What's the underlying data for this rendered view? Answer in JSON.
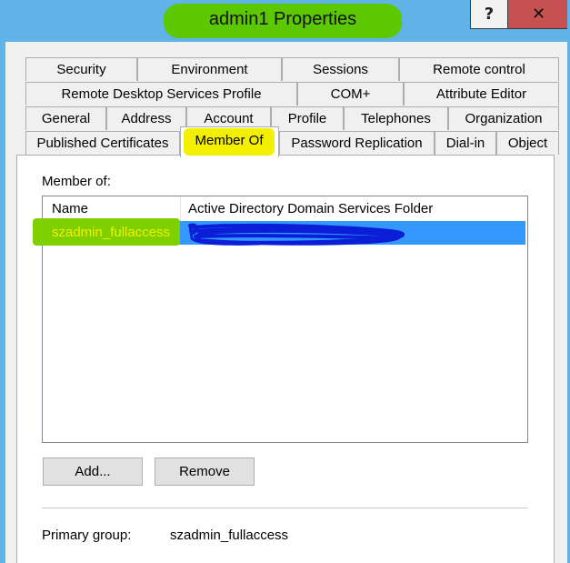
{
  "window": {
    "title": "admin1 Properties",
    "help_label": "?",
    "close_label": "✕"
  },
  "tabs": {
    "row1": [
      "Security",
      "Environment",
      "Sessions",
      "Remote control"
    ],
    "row2": [
      "Remote Desktop Services Profile",
      "COM+",
      "Attribute Editor"
    ],
    "row3": [
      "General",
      "Address",
      "Account",
      "Profile",
      "Telephones",
      "Organization"
    ],
    "row4": [
      "Published Certificates",
      "Member Of",
      "Password Replication",
      "Dial-in",
      "Object"
    ],
    "active": "Member Of"
  },
  "member_of": {
    "label": "Member of:",
    "columns": [
      "Name",
      "Active Directory Domain Services Folder"
    ],
    "rows": [
      {
        "name": "szadmin_fullaccess",
        "folder": ""
      }
    ]
  },
  "buttons": {
    "add": "Add...",
    "remove": "Remove"
  },
  "primary_group": {
    "label": "Primary group:",
    "value": "szadmin_fullaccess"
  },
  "colors": {
    "frame": "#5fb3e6",
    "close": "#c75050",
    "selection": "#3399ff",
    "title_highlight": "#5cc800",
    "tab_highlight": "#f2ef00",
    "name_highlight": "#7ed000",
    "scribble": "#0a1ed8"
  }
}
